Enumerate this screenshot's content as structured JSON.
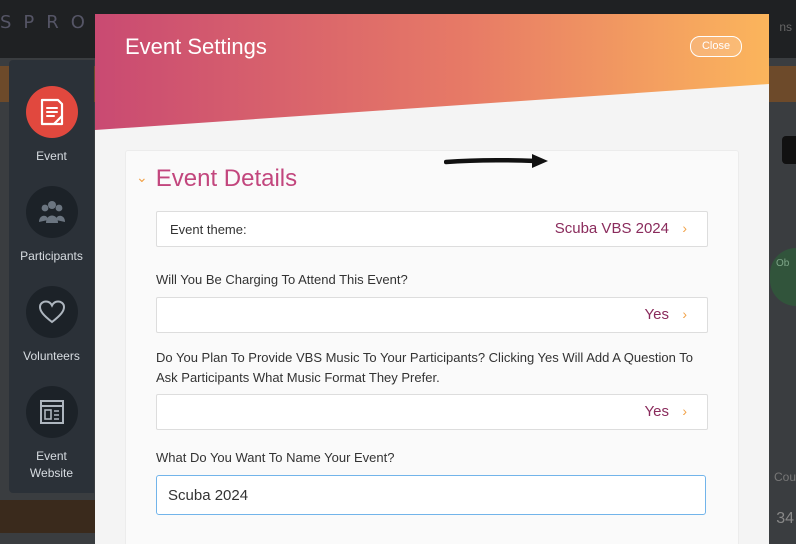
{
  "background": {
    "logo": "SPRO",
    "right_text": "ns",
    "side_badge": "Ob",
    "right_bottom_label": "Cou",
    "right_bottom_number": "34"
  },
  "sidebar": {
    "items": [
      {
        "label": "Event",
        "icon": "event-document-icon",
        "active": true
      },
      {
        "label": "Participants",
        "icon": "participants-icon",
        "active": false
      },
      {
        "label": "Volunteers",
        "icon": "heart-icon",
        "active": false
      },
      {
        "label": "Event Website",
        "icon": "website-icon",
        "active": false
      }
    ]
  },
  "modal": {
    "title": "Event Settings",
    "close_label": "Close",
    "section_title": "Event Details",
    "event_theme": {
      "label": "Event theme:",
      "value": "Scuba VBS 2024"
    },
    "charging": {
      "question": "Will You Be Charging To Attend This Event?",
      "value": "Yes"
    },
    "music": {
      "question": "Do You Plan To Provide VBS Music To Your Participants? Clicking Yes Will Add A Question To Ask Participants What Music Format They Prefer.",
      "value": "Yes"
    },
    "event_name": {
      "question": "What Do You Want To Name Your Event?",
      "value": "Scuba 2024"
    }
  },
  "colors": {
    "accent_pink": "#c2467d",
    "value_plum": "#8a2b5c",
    "chevron_orange": "#f2a34a",
    "active_red": "#e1483e"
  }
}
